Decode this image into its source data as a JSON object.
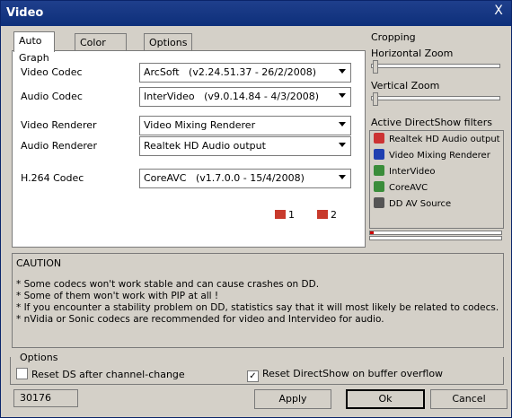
{
  "window": {
    "title": "Video",
    "close_label": "X"
  },
  "tabs": [
    {
      "label": "Auto Graph",
      "active": true
    },
    {
      "label": "Color Controls",
      "active": false
    },
    {
      "label": "Options",
      "active": false
    }
  ],
  "autograph": {
    "video_codec": {
      "label": "Video Codec",
      "value": "ArcSoft   (v2.24.51.37 - 26/2/2008)"
    },
    "audio_codec": {
      "label": "Audio Codec",
      "value": "InterVideo   (v9.0.14.84 - 4/3/2008)"
    },
    "video_renderer": {
      "label": "Video Renderer",
      "value": "Video Mixing Renderer"
    },
    "audio_renderer": {
      "label": "Audio Renderer",
      "value": "Realtek HD Audio output"
    },
    "h264_codec": {
      "label": "H.264 Codec",
      "value": "CoreAVC   (v1.7.0.0 - 15/4/2008)"
    },
    "external_links": [
      {
        "label": "1"
      },
      {
        "label": "2"
      }
    ]
  },
  "cropping": {
    "title": "Cropping",
    "horizontal_zoom": {
      "label": "Horizontal Zoom",
      "value": 0
    },
    "vertical_zoom": {
      "label": "Vertical Zoom",
      "value": 0
    }
  },
  "active_filters": {
    "title": "Active DirectShow filters",
    "items": [
      {
        "label": "Realtek HD Audio output",
        "icon": "speaker-icon"
      },
      {
        "label": "Video Mixing Renderer",
        "icon": "monitor-icon"
      },
      {
        "label": "InterVideo",
        "icon": "filter-icon"
      },
      {
        "label": "CoreAVC",
        "icon": "filter-icon"
      },
      {
        "label": "DD AV Source",
        "icon": "source-icon"
      }
    ]
  },
  "caution": {
    "title": "CAUTION",
    "lines": [
      "*  Some codecs won't work stable and can cause crashes on DD.",
      "*  Some of them won't work with PIP at all !",
      "*  If you encounter a stability problem on DD, statistics say that it will most likely be related to codecs.",
      "*  nVidia or Sonic codecs are recommended for video and Intervideo for audio."
    ]
  },
  "options": {
    "title": "Options",
    "reset_ds": {
      "label": "Reset DS after channel-change",
      "checked": false
    },
    "reset_directshow": {
      "label": "Reset DirectShow on buffer overflow",
      "checked": true
    }
  },
  "status_value": "30176",
  "buttons": {
    "apply": "Apply",
    "ok": "Ok",
    "cancel": "Cancel"
  },
  "colors": {
    "titlebar": "#0d2f7a",
    "window_bg": "#d4d0c8"
  }
}
